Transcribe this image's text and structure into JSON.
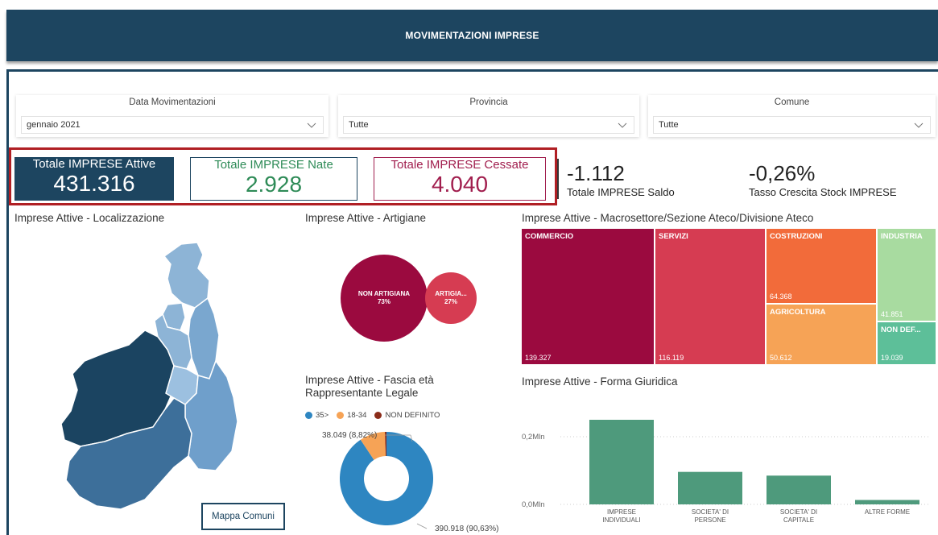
{
  "header": {
    "title": "MOVIMENTAZIONI IMPRESE"
  },
  "filters": {
    "data": {
      "title": "Data Movimentazioni",
      "value": "gennaio 2021"
    },
    "provincia": {
      "title": "Provincia",
      "value": "Tutte"
    },
    "comune": {
      "title": "Comune",
      "value": "Tutte"
    }
  },
  "kpis": {
    "attive": {
      "label": "Totale IMPRESE Attive",
      "value": "431.316",
      "color": "#1d4560"
    },
    "nate": {
      "label": "Totale IMPRESE Nate",
      "value": "2.928",
      "color": "#2e8b57"
    },
    "cessate": {
      "label": "Totale IMPRESE Cessate",
      "value": "4.040",
      "color": "#a11e4e"
    },
    "saldo": {
      "label": "Totale IMPRESE Saldo",
      "value": "-1.112"
    },
    "tasso": {
      "label": "Tasso Crescita Stock IMPRESE",
      "value": "-0,26%"
    }
  },
  "visuals": {
    "map": {
      "title": "Imprese Attive - Localizzazione",
      "button": "Mappa Comuni"
    },
    "artigiane": {
      "title": "Imprese Attive - Artigiane",
      "bubbles": [
        {
          "label": "NON ARTIGIANA",
          "pct": "73%",
          "value": 73,
          "color": "#9b0a3f"
        },
        {
          "label": "ARTIGIA...",
          "pct": "27%",
          "value": 27,
          "color": "#d63c52"
        }
      ]
    },
    "treemap": {
      "title": "Imprese Attive - Macrosettore/Sezione Ateco/Divisione Ateco",
      "cells": [
        {
          "label": "COMMERCIO",
          "value": "139.327",
          "color": "#9b0a3f"
        },
        {
          "label": "SERVIZI",
          "value": "116.119",
          "color": "#d63c52"
        },
        {
          "label": "COSTRUZIONI",
          "value": "64.368",
          "color": "#f26b3a"
        },
        {
          "label": "AGRICOLTURA",
          "value": "50.612",
          "color": "#f6a356"
        },
        {
          "label": "INDUSTRIA",
          "value": "41.851",
          "color": "#a8dba0"
        },
        {
          "label": "NON DEF...",
          "value": "19.039",
          "color": "#5dbf99"
        }
      ]
    },
    "fascia": {
      "title": "Imprese Attive - Fascia età Rappresentante Legale",
      "title_line1": "Imprese Attive - Fascia età",
      "title_line2": "Rappresentante Legale",
      "legend": [
        {
          "label": "35>",
          "color": "#2e86c1"
        },
        {
          "label": "18-34",
          "color": "#f6a356"
        },
        {
          "label": "NON DEFINITO",
          "color": "#8b2c1a"
        }
      ],
      "label_small": "38.049 (8,82%)",
      "label_big": "390.918 (90,63%)"
    },
    "forma": {
      "title": "Imprese Attive - Forma Giuridica"
    }
  },
  "chart_data": [
    {
      "type": "pie",
      "title": "Imprese Attive - Fascia età Rappresentante Legale",
      "categories": [
        "35>",
        "18-34",
        "NON DEFINITO"
      ],
      "values": [
        390918,
        38049,
        2349
      ],
      "labels": [
        "390.918 (90,63%)",
        "38.049 (8,82%)",
        ""
      ]
    },
    {
      "type": "bar",
      "title": "Imprese Attive - Forma Giuridica",
      "categories": [
        "IMPRESE INDIVIDUALI",
        "SOCIETA' DI PERSONE",
        "SOCIETA' DI CAPITALE",
        "ALTRE FORME"
      ],
      "category_lines": [
        [
          "IMPRESE",
          "INDIVIDUALI"
        ],
        [
          "SOCIETA' DI",
          "PERSONE"
        ],
        [
          "SOCIETA' DI",
          "CAPITALE"
        ],
        [
          "ALTRE FORME"
        ]
      ],
      "values": [
        250000,
        96000,
        85000,
        13000
      ],
      "ylim": [
        0,
        300000
      ],
      "yticks": [
        {
          "value": 0,
          "label": "0,0Mln"
        },
        {
          "value": 200000,
          "label": "0,2Mln"
        }
      ],
      "color": "#4e9a7c"
    }
  ]
}
